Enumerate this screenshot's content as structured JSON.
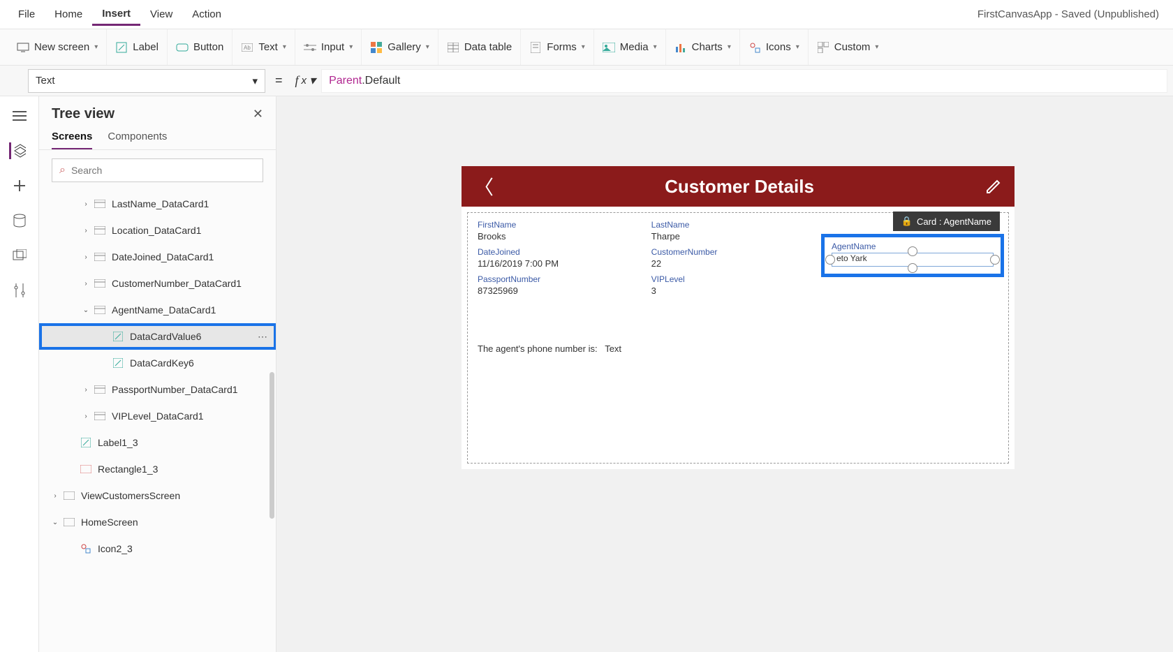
{
  "app_title": "FirstCanvasApp - Saved (Unpublished)",
  "menus": {
    "file": "File",
    "home": "Home",
    "insert": "Insert",
    "view": "View",
    "action": "Action"
  },
  "ribbon": {
    "new_screen": "New screen",
    "label": "Label",
    "button": "Button",
    "text_dd": "Text",
    "input_dd": "Input",
    "gallery": "Gallery",
    "data_table": "Data table",
    "forms": "Forms",
    "media": "Media",
    "charts": "Charts",
    "icons": "Icons",
    "custom": "Custom"
  },
  "formula": {
    "property": "Text",
    "fx_token_parent": "Parent",
    "fx_token_rest": ".Default"
  },
  "treeview": {
    "title": "Tree view",
    "tab_screens": "Screens",
    "tab_components": "Components",
    "search_placeholder": "Search",
    "items": {
      "lastname": "LastName_DataCard1",
      "location": "Location_DataCard1",
      "datejoined": "DateJoined_DataCard1",
      "customernumber": "CustomerNumber_DataCard1",
      "agentname": "AgentName_DataCard1",
      "datacardvalue6": "DataCardValue6",
      "datacardkey6": "DataCardKey6",
      "passportnumber": "PassportNumber_DataCard1",
      "viplevel": "VIPLevel_DataCard1",
      "label1_3": "Label1_3",
      "rectangle1_3": "Rectangle1_3",
      "viewcustomersscreen": "ViewCustomersScreen",
      "homescreen": "HomeScreen",
      "icon2_3": "Icon2_3"
    }
  },
  "canvas": {
    "header": "Customer Details",
    "card_tag": "Card : AgentName",
    "fields": {
      "firstname_label": "FirstName",
      "firstname_value": "Brooks",
      "lastname_label": "LastName",
      "lastname_value": "Tharpe",
      "datejoined_label": "DateJoined",
      "datejoined_value": "11/16/2019 7:00 PM",
      "customernumber_label": "CustomerNumber",
      "customernumber_value": "22",
      "passportnumber_label": "PassportNumber",
      "passportnumber_value": "87325969",
      "viplevel_label": "VIPLevel",
      "viplevel_value": "3",
      "agentname_label": "AgentName",
      "agentname_value": "eto Yark"
    },
    "agent_line_label": "The agent's phone number is:",
    "agent_line_value": "Text"
  }
}
